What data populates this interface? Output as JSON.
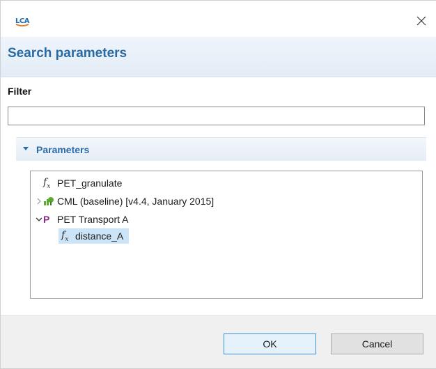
{
  "titlebar": {
    "logo_text": "LCA",
    "close_icon": "close-icon"
  },
  "header": {
    "title": "Search parameters"
  },
  "filter": {
    "label": "Filter",
    "value": "",
    "placeholder": ""
  },
  "section": {
    "title": "Parameters",
    "expanded": true
  },
  "tree": {
    "items": [
      {
        "label": "PET_granulate",
        "icon": "formula-icon",
        "level": 0,
        "expander": "none",
        "selected": false
      },
      {
        "label": "CML (baseline) [v4.4, January 2015]",
        "icon": "impact-method-icon",
        "level": 0,
        "expander": "collapsed",
        "selected": false
      },
      {
        "label": "PET Transport A",
        "icon": "process-icon",
        "level": 0,
        "expander": "expanded",
        "selected": false
      },
      {
        "label": "distance_A",
        "icon": "formula-icon",
        "level": 1,
        "expander": "none",
        "selected": true
      }
    ]
  },
  "footer": {
    "ok_label": "OK",
    "cancel_label": "Cancel"
  },
  "colors": {
    "accent": "#2a6ba6",
    "selection": "#cce4f7",
    "process_icon": "#8a2a8a",
    "impact_icon": "#5aaa2e"
  }
}
